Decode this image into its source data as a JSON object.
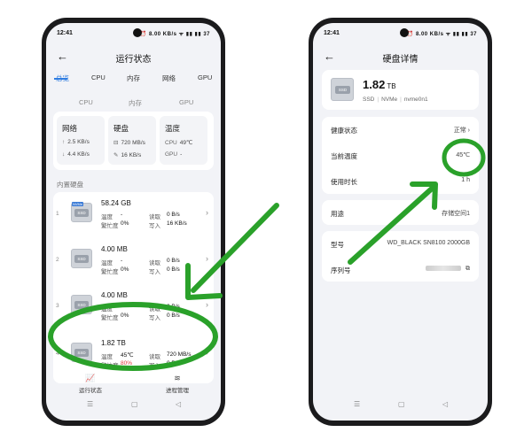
{
  "statusbar": {
    "time": "12:41",
    "icons": "⏰ 8.00 KB/s ᯤ ▮▮ ▮▮ 37"
  },
  "left": {
    "title": "运行状态",
    "tabs": [
      "总览",
      "CPU",
      "内存",
      "网络",
      "GPU"
    ],
    "subtabs": [
      "CPU",
      "内存",
      "GPU"
    ],
    "cards": {
      "network": {
        "title": "网络",
        "up": "2.5 KB/s",
        "down": "4.4 KB/s"
      },
      "disk": {
        "title": "硬盘",
        "read": "720 MB/s",
        "write": "16 KB/s"
      },
      "temp": {
        "title": "温度",
        "cpu_label": "CPU",
        "cpu_value": "49℃",
        "gpu_label": "GPU",
        "gpu_value": "-"
      }
    },
    "section": "内置硬盘",
    "disks": [
      {
        "index": "1",
        "size": "58.24 GB",
        "temp_label": "温度",
        "temp": "-",
        "busy_label": "繁忙度",
        "busy": "0%",
        "read_label": "读取",
        "read": "0 B/s",
        "write_label": "写入",
        "write": "16 KB/s",
        "badge": "NVMe"
      },
      {
        "index": "2",
        "size": "4.00 MB",
        "temp_label": "温度",
        "temp": "-",
        "busy_label": "繁忙度",
        "busy": "0%",
        "read_label": "读取",
        "read": "0 B/s",
        "write_label": "写入",
        "write": "0 B/s"
      },
      {
        "index": "3",
        "size": "4.00 MB",
        "temp_label": "温度",
        "temp": "-",
        "busy_label": "繁忙度",
        "busy": "0%",
        "read_label": "读取",
        "read": "0 B/s",
        "write_label": "写入",
        "write": "0 B/s"
      },
      {
        "index": "4",
        "size": "1.82 TB",
        "temp_label": "温度",
        "temp": "45℃",
        "busy_label": "繁忙度",
        "busy": "80%",
        "read_label": "读取",
        "read": "720 MB/s",
        "write_label": "写入",
        "write": "0 B/s"
      }
    ],
    "disk_img_label": "SSD",
    "nav": [
      {
        "label": "运行状态",
        "icon": "📈"
      },
      {
        "label": "进程管理",
        "icon": "≋"
      }
    ]
  },
  "right": {
    "title": "硬盘详情",
    "size_value": "1.82",
    "size_unit": "TB",
    "meta": [
      "SSD",
      "NVMe",
      "nvme0n1"
    ],
    "health_label": "健康状态",
    "health_value": "正常",
    "temp_label": "当前温度",
    "temp_value": "45℃",
    "uptime_label": "使用时长",
    "uptime_value": "1 h",
    "usage_label": "用途",
    "usage_value": "存储空间1",
    "model_label": "型号",
    "model_value": "WD_BLACK SN8100 2000GB",
    "serial_label": "序列号"
  },
  "sysnav": {
    "menu": "☰",
    "home": "▢",
    "back": "◁"
  },
  "colors": {
    "accent": "#2f7de1",
    "annotation": "#2aa12a",
    "alert": "#e03b3b"
  }
}
